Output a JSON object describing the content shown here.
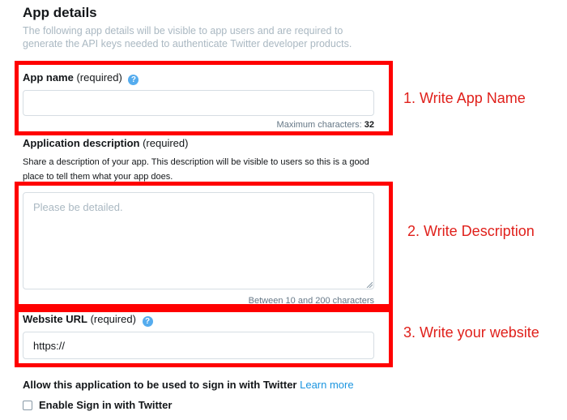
{
  "section": {
    "title": "App details",
    "subtitle": "The following app details will be visible to app users and are required to generate the API keys needed to authenticate Twitter developer products."
  },
  "app_name": {
    "label": "App name",
    "required": "(required)",
    "value": "",
    "hint_prefix": "Maximum characters:",
    "hint_value": "32"
  },
  "description": {
    "label": "Application description",
    "required": "(required)",
    "help_text": "Share a description of your app. This description will be visible to users so this is a good place to tell them what your app does.",
    "placeholder": "Please be detailed.",
    "hint": "Between 10 and 200 characters"
  },
  "website": {
    "label": "Website URL",
    "required": "(required)",
    "value": "https://"
  },
  "sign_in": {
    "label": "Allow this application to be used to sign in with Twitter",
    "learn_more": "Learn more",
    "checkbox_label": "Enable Sign in with Twitter",
    "checked": false
  },
  "annotations": {
    "step1": "1. Write App Name",
    "step2": "2. Write Description",
    "step3": "3. Write your website"
  },
  "colors": {
    "annotation_red": "#ff0000",
    "link_blue": "#1b95e0",
    "help_icon_blue": "#55acee"
  }
}
